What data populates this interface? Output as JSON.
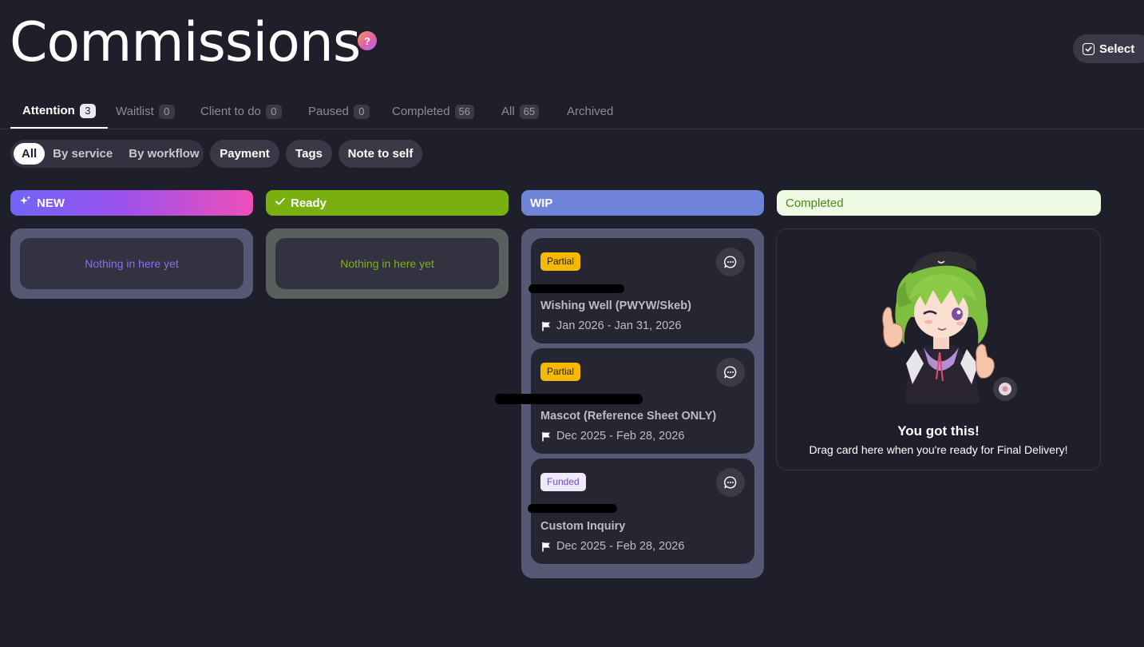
{
  "header": {
    "title": "Commissions",
    "help_glyph": "?",
    "select_label": "Select"
  },
  "tabs": [
    {
      "label": "Attention",
      "count": "3",
      "active": true
    },
    {
      "label": "Waitlist",
      "count": "0"
    },
    {
      "label": "Client to do",
      "count": "0"
    },
    {
      "label": "Paused",
      "count": "0"
    },
    {
      "label": "Completed",
      "count": "56"
    },
    {
      "label": "All",
      "count": "65"
    },
    {
      "label": "Archived",
      "count": ""
    }
  ],
  "filters": {
    "segments": [
      "All",
      "By service",
      "By workflow"
    ],
    "pills": [
      "Payment",
      "Tags",
      "Note to self"
    ]
  },
  "columns": {
    "new": {
      "label": "NEW",
      "empty_text": "Nothing in here yet",
      "color": "#8d6ef2"
    },
    "ready": {
      "label": "Ready",
      "empty_text": "Nothing in here yet",
      "color": "#79af11"
    },
    "wip": {
      "label": "WIP",
      "color": "#6f84d8",
      "cards": [
        {
          "badge": "Partial",
          "title": "Wishing Well (PWYW/Skeb)",
          "dates": "Jan 2026 - Jan 31, 2026"
        },
        {
          "badge": "Partial",
          "title": "Mascot (Reference Sheet ONLY)",
          "dates": "Dec 2025 - Feb 28, 2026"
        },
        {
          "badge": "Funded",
          "title": "Custom Inquiry",
          "dates": "Dec 2025 - Feb 28, 2026"
        }
      ]
    },
    "completed": {
      "label": "Completed",
      "heading": "You got this!",
      "subtext": "Drag card here when you're ready for Final Delivery!"
    }
  },
  "icons": {
    "help": "help-icon",
    "select": "checkbox-icon",
    "new": "sparkle-icon",
    "ready": "check-icon",
    "chat": "chat-bubble-icon",
    "flag": "flag-icon"
  }
}
